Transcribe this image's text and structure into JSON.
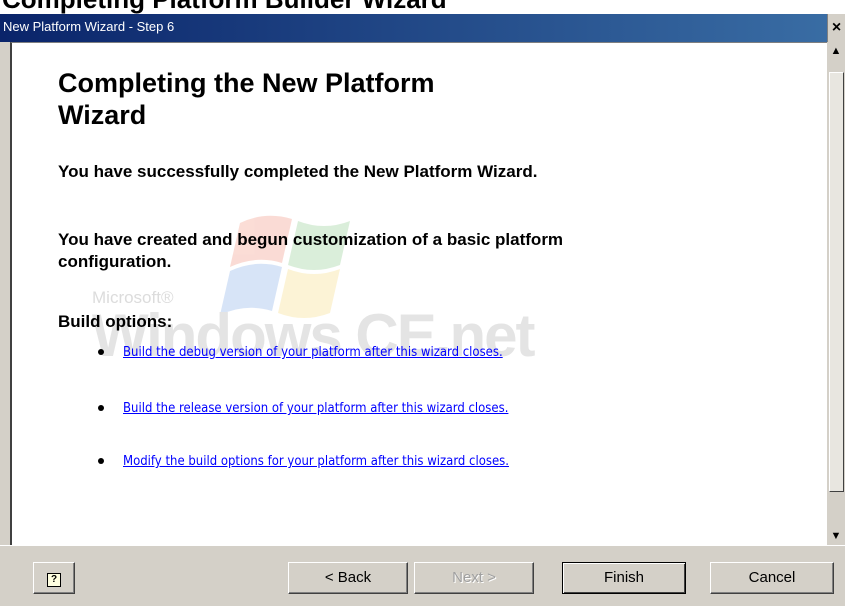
{
  "page": {
    "title": "Completing Platform Builder Wizard"
  },
  "window": {
    "title": "New Platform Wizard - Step 6",
    "close_glyph": "×"
  },
  "content": {
    "heading": "Completing the New Platform Wizard",
    "para1": "You have successfully completed the New Platform Wizard.",
    "para2": "You have created and begun customization of a basic platform configuration.",
    "build_options_label": "Build options:",
    "options": [
      {
        "label": "Build the debug version of your platform after this wizard closes."
      },
      {
        "label": "Build the release version of your platform after this wizard closes."
      },
      {
        "label": "Modify the build options for your platform after this wizard closes."
      }
    ],
    "watermark": {
      "microsoft": "Microsoft®",
      "windows": "Windows CE.net"
    }
  },
  "buttons": {
    "help_glyph": "?",
    "back": "< Back",
    "next": "Next >",
    "finish": "Finish",
    "cancel": "Cancel"
  },
  "icons": {
    "help": "help-icon",
    "close": "close-icon",
    "scroll_up": "scroll-up-arrow-icon",
    "scroll_down": "scroll-down-arrow-icon",
    "bullet": "bullet-icon"
  },
  "colors": {
    "titlebar_start": "#0a246a",
    "titlebar_end": "#3a6ea5",
    "link": "#0000ff",
    "dialog_bg": "#d4d0c8"
  }
}
